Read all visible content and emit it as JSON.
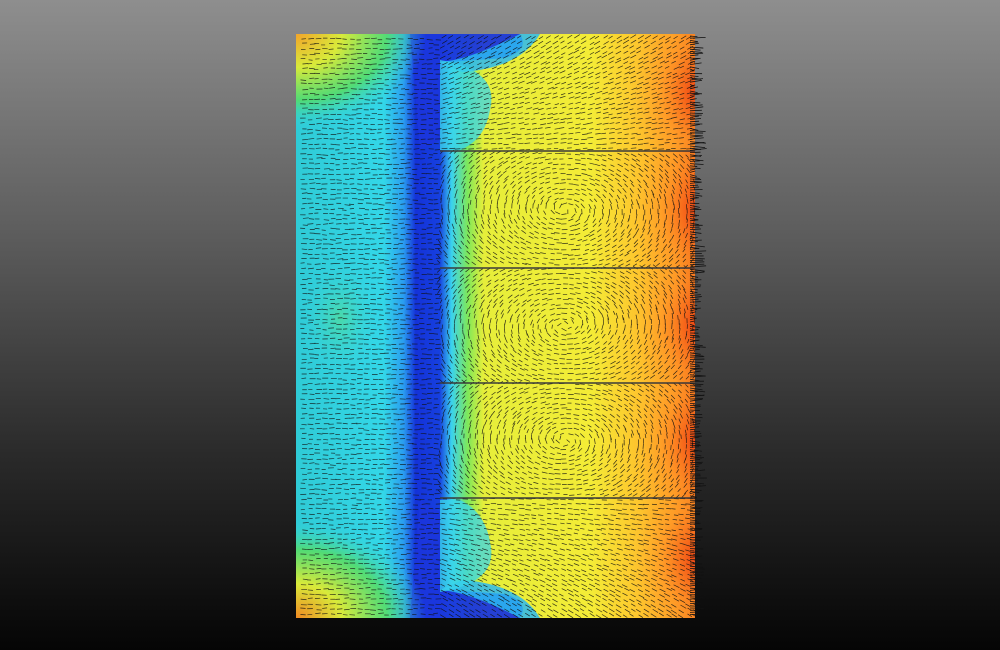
{
  "figure": {
    "subject": "",
    "colormap": [
      "#1a1ad0",
      "#2aa8ff",
      "#3fe6ee",
      "#35e05a",
      "#f2f03a",
      "#ffb22a",
      "#f24a14"
    ],
    "background_gradient": [
      "#8e8e8e",
      "#050505"
    ],
    "vector_color": "#111111",
    "separator_color": "#3a3a3a",
    "bays": 5
  }
}
